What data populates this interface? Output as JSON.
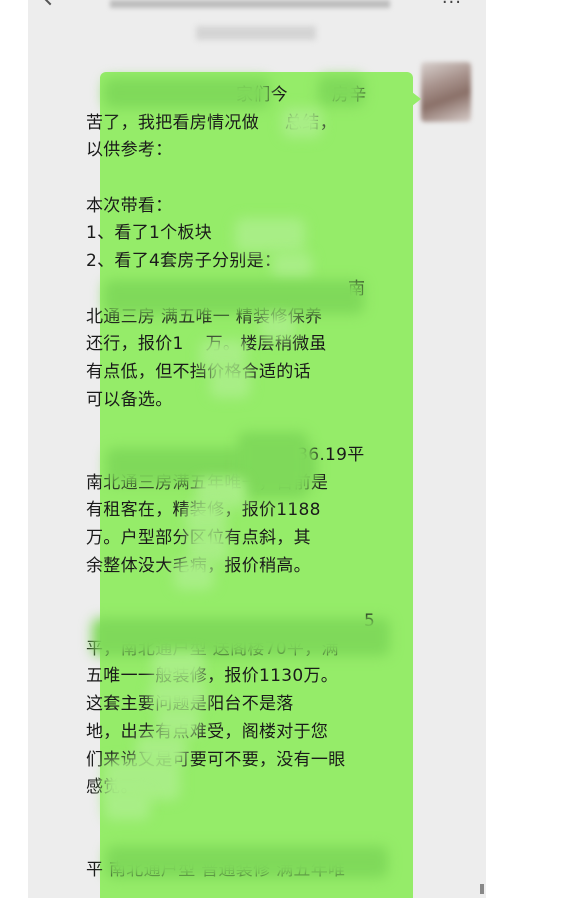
{
  "header": {
    "title": "",
    "more_label": "···"
  },
  "message": {
    "lines": [
      "",
      "苦了，我把看房情况做",
      "以供参考：",
      "",
      "本次带看：",
      "1、看了1个板块",
      "2、看了4套房子",
      "",
      "北通三房 满五唯一 精装修保养",
      "还行，报价1",
      "有点低，但不挡价格合适的话",
      "可以备选。",
      "",
      "",
      "南北通三房满五年唯一，目前是",
      "有租客在，精装修，报价1188",
      "万。户型部分区位有点斜，其",
      "余整体没大毛病，报价稍高。",
      "",
      "",
      "平，南北通户型 送阁楼70平，满",
      "五唯一一般装修，报价1130万。",
      "这套主要问题是阳台不是落",
      "地，出去有点难受，阁楼对于您",
      "们来说又是可要可不要，没有一眼",
      "感觉。",
      "",
      "",
      "平 南北通户型 普通装修 满五年唯"
    ],
    "fragments": {
      "line1_mid": "家们今",
      "line1_end": "房辛",
      "line2_end": "总结，",
      "line7_end": "分别是：",
      "line8_end": "南",
      "line10_end": "万。楼层稍微虽",
      "line14_end": "136.19平",
      "line21_end": "5"
    }
  }
}
